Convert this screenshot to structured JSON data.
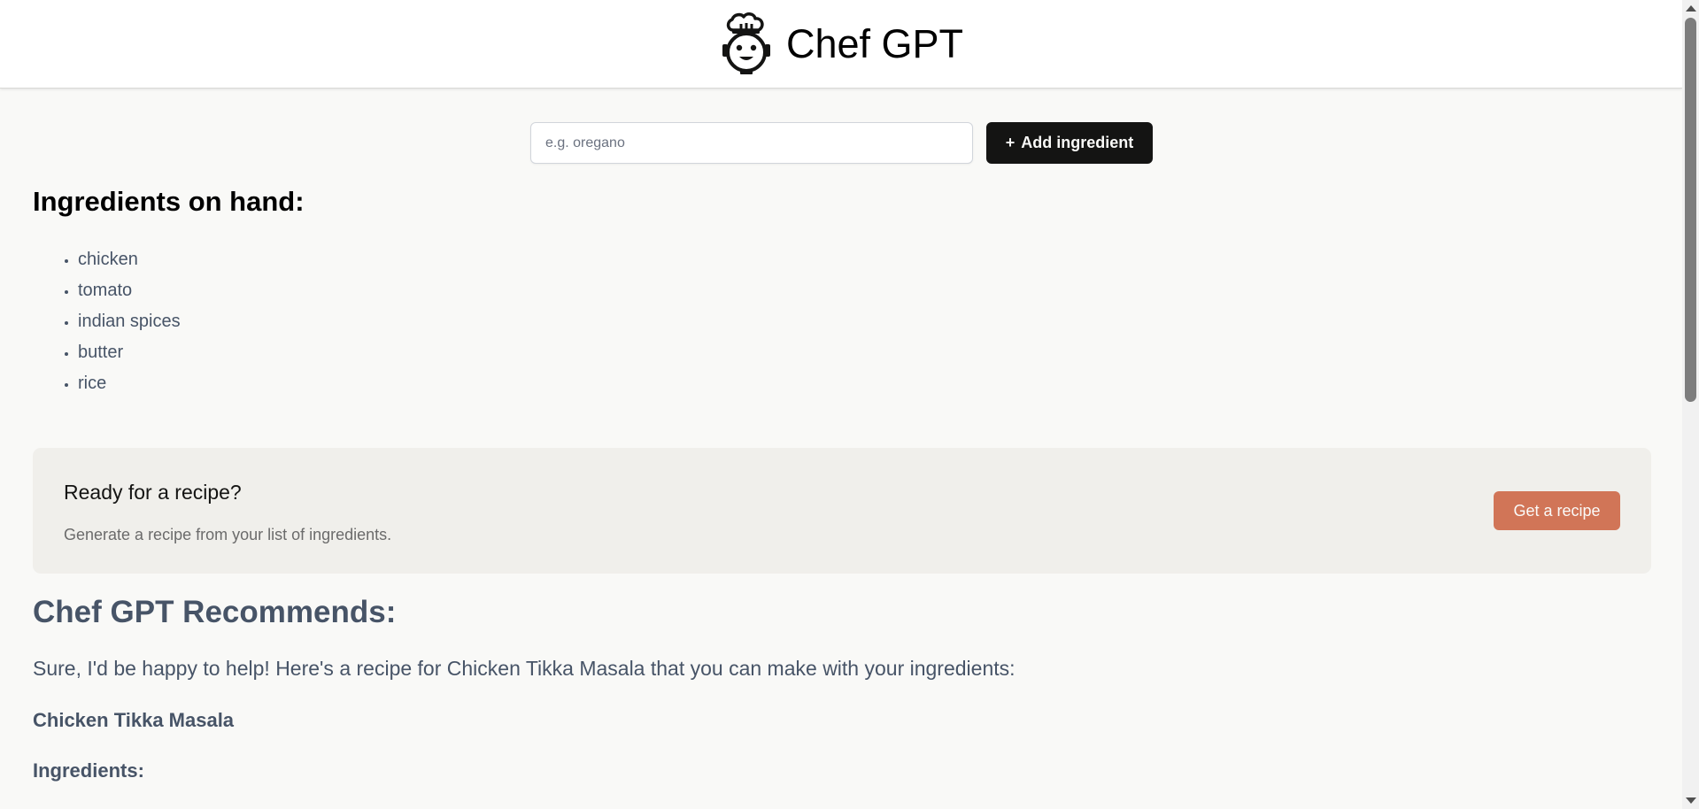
{
  "header": {
    "title": "Chef GPT",
    "logo_icon": "chef-robot-icon"
  },
  "add_form": {
    "placeholder": "e.g. oregano",
    "value": "",
    "button_icon": "+",
    "button_label": "Add ingredient"
  },
  "ingredients": {
    "title": "Ingredients on hand:",
    "items": [
      "chicken",
      "tomato",
      "indian spices",
      "butter",
      "rice"
    ]
  },
  "recipe_card": {
    "title": "Ready for a recipe?",
    "description": "Generate a recipe from your list of ingredients.",
    "button_label": "Get a recipe"
  },
  "recommendation": {
    "heading": "Chef GPT Recommends:",
    "intro": "Sure, I'd be happy to help! Here's a recipe for Chicken Tikka Masala that you can make with your ingredients:",
    "recipe_name": "Chicken Tikka Masala",
    "ingredients_label": "Ingredients:"
  },
  "colors": {
    "accent": "#d17557",
    "dark_button": "#141413",
    "body_text": "#475467",
    "card_bg": "#f0efeb",
    "page_bg": "#f9f9f7"
  }
}
